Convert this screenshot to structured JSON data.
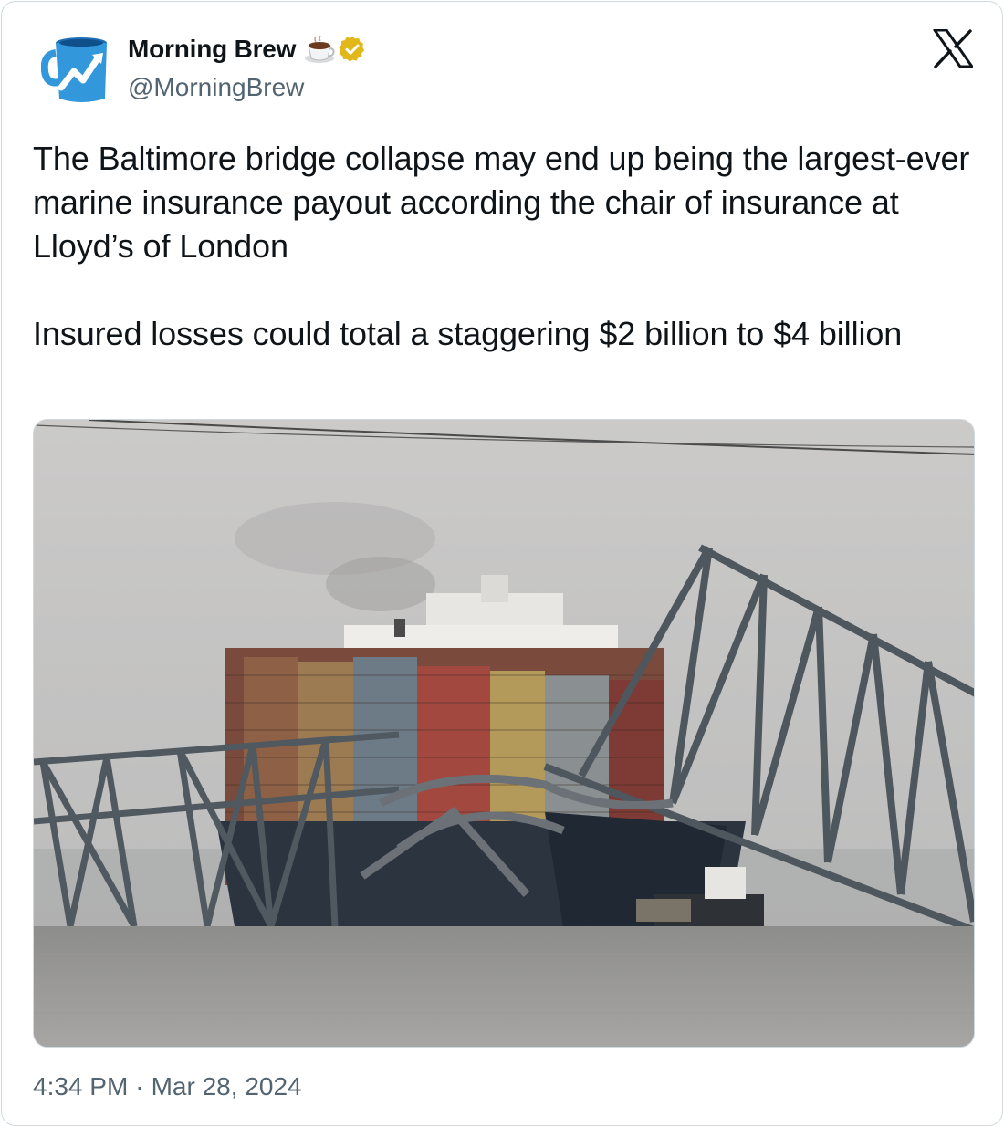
{
  "author": {
    "display_name": "Morning Brew",
    "handle": "@MorningBrew",
    "avatar_icon": "coffee-mug-chart-logo",
    "emoji_icon": "coffee-cup-icon",
    "verified_icon": "verified-badge-gold",
    "brand_color": "#3398DB",
    "verified_color": "#E2B719"
  },
  "platform_icon": "x-logo",
  "tweet": {
    "text": "The Baltimore bridge collapse may end up being the largest-ever marine insurance payout according the chair of insurance at Lloyd’s of London\n\nInsured losses could total a staggering $2 billion to $4 billion"
  },
  "media": {
    "description_icon": "collapsed-bridge-container-ship-photo"
  },
  "meta": {
    "time": "4:34 PM",
    "separator": "·",
    "date": "Mar 28, 2024"
  },
  "colors": {
    "text_primary": "#0F1419",
    "text_secondary": "#536471",
    "border": "#CFD9DE"
  }
}
